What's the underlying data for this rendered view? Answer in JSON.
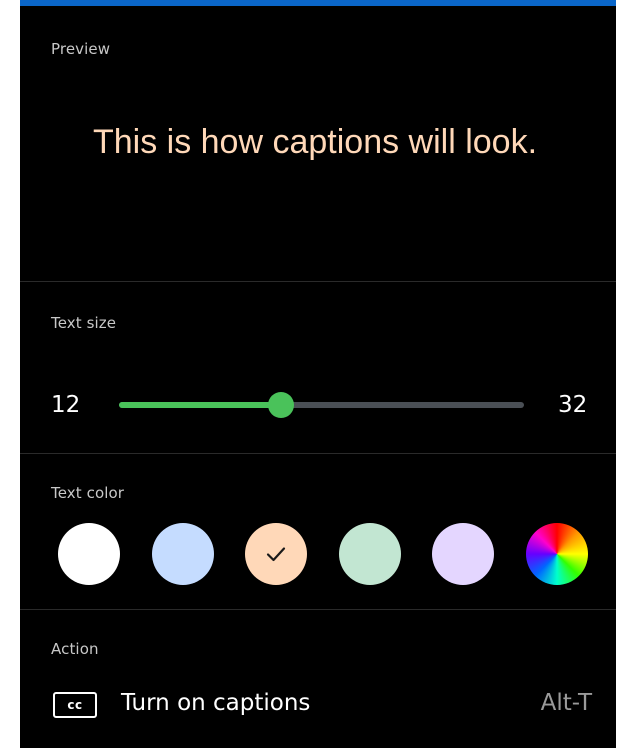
{
  "preview": {
    "label": "Preview",
    "text": "This is how captions will look.",
    "text_color": "#ffd8b8"
  },
  "text_size": {
    "label": "Text size",
    "min_label": "12",
    "max_label": "32",
    "min": 12,
    "max": 32,
    "value": 20,
    "accent_color": "#4ac25a"
  },
  "text_color": {
    "label": "Text color",
    "selected_index": 2,
    "swatches": [
      {
        "name": "white",
        "color": "#ffffff"
      },
      {
        "name": "light-blue",
        "color": "#c5dcff"
      },
      {
        "name": "peach",
        "color": "#ffd8b8"
      },
      {
        "name": "mint",
        "color": "#c2e6d2"
      },
      {
        "name": "lavender",
        "color": "#e4d6ff"
      },
      {
        "name": "custom-color",
        "color": "rainbow"
      }
    ]
  },
  "action": {
    "label": "Action",
    "icon": "closed-captions-icon",
    "icon_text": "cc",
    "button_label": "Turn on captions",
    "shortcut": "Alt-T"
  }
}
